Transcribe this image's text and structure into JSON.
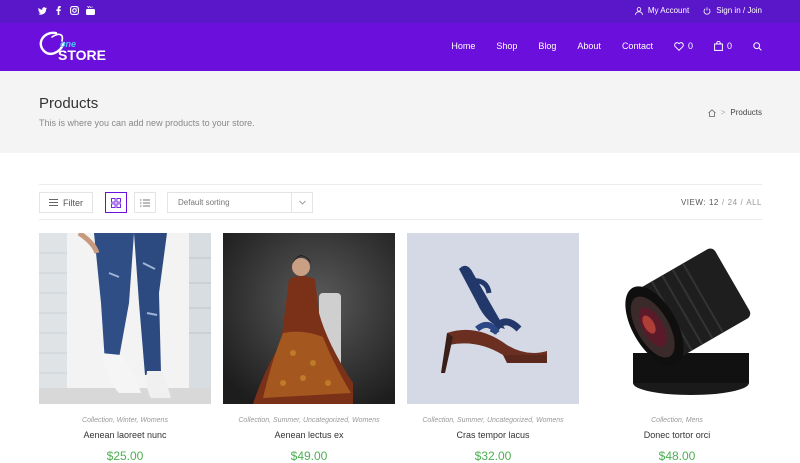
{
  "topbar": {
    "social_icons": [
      "twitter-icon",
      "facebook-icon",
      "instagram-icon",
      "youtube-icon"
    ],
    "account_label": "My Account",
    "signin_label": "Sign in / Join"
  },
  "header": {
    "logo_text_main": "STORE",
    "logo_text_small": "one",
    "nav": [
      "Home",
      "Shop",
      "Blog",
      "About",
      "Contact"
    ],
    "wishlist_count": "0",
    "cart_count": "0"
  },
  "page": {
    "title": "Products",
    "subtitle": "This is where you can add new products to your store.",
    "breadcrumb_current": "Products"
  },
  "toolbar": {
    "filter_label": "Filter",
    "sort_selected": "Default sorting",
    "view_label": "VIEW:",
    "view_options": [
      "12",
      "24",
      "ALL"
    ]
  },
  "products": [
    {
      "categories": "Collection, Winter, Womens",
      "name": "Aenean laoreet nunc",
      "price": "$25.00"
    },
    {
      "categories": "Collection, Summer, Uncategorized, Womens",
      "name": "Aenean lectus ex",
      "price": "$49.00"
    },
    {
      "categories": "Collection, Summer, Uncategorized, Womens",
      "name": "Cras tempor lacus",
      "price": "$32.00"
    },
    {
      "categories": "Collection, Mens",
      "name": "Donec tortor orci",
      "price": "$48.00"
    }
  ],
  "colors": {
    "topbar": "#5a17c9",
    "header": "#6a0fdc",
    "accent": "#6a0fdc",
    "price": "#4caf50"
  }
}
